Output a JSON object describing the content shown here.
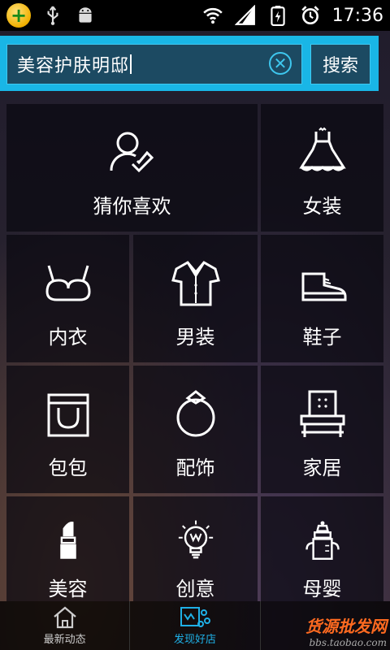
{
  "status_bar": {
    "time": "17:36",
    "icons": [
      "app-badge-icon",
      "usb-icon",
      "android-icon",
      "wifi-icon",
      "signal-icon",
      "battery-icon",
      "alarm-icon"
    ]
  },
  "search": {
    "query": "美容护肤明邸",
    "button_label": "搜索"
  },
  "grid": [
    {
      "id": "guess",
      "label": "猜你喜欢",
      "icon": "person-check-icon"
    },
    {
      "id": "women",
      "label": "女装",
      "icon": "dress-icon"
    },
    {
      "id": "underwear",
      "label": "内衣",
      "icon": "bra-icon"
    },
    {
      "id": "men",
      "label": "男装",
      "icon": "shirt-icon"
    },
    {
      "id": "shoes",
      "label": "鞋子",
      "icon": "shoe-icon"
    },
    {
      "id": "bags",
      "label": "包包",
      "icon": "bag-icon"
    },
    {
      "id": "accessories",
      "label": "配饰",
      "icon": "ring-icon"
    },
    {
      "id": "home",
      "label": "家居",
      "icon": "chair-icon"
    },
    {
      "id": "beauty",
      "label": "美容",
      "icon": "lipstick-icon"
    },
    {
      "id": "creative",
      "label": "创意",
      "icon": "bulb-icon"
    },
    {
      "id": "baby",
      "label": "母婴",
      "icon": "bottle-icon"
    }
  ],
  "bottom_nav": [
    {
      "label": "最新动态",
      "icon": "home-icon",
      "active": false
    },
    {
      "label": "发现好店",
      "icon": "discover-icon",
      "active": true
    },
    {
      "label": "",
      "icon": "",
      "active": false
    }
  ],
  "watermark": {
    "top": "货源批发网",
    "bottom": "bbs.taobao.com"
  },
  "colors": {
    "accent": "#19b6e6",
    "search_fill": "#1c4a62"
  }
}
